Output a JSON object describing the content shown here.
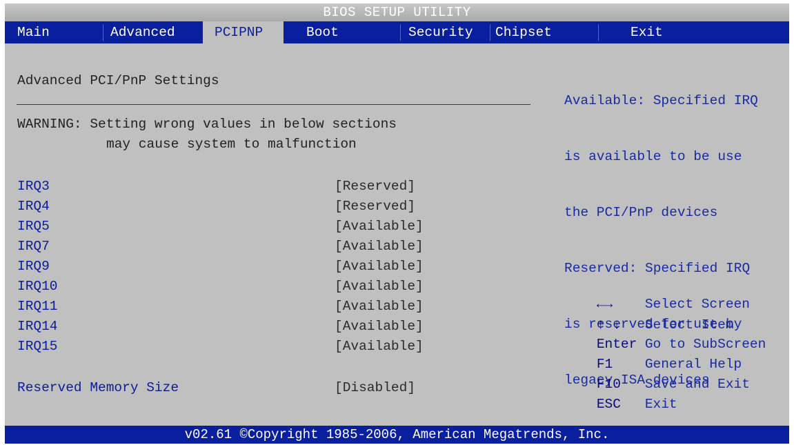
{
  "title": "BIOS SETUP UTILITY",
  "tabs": [
    {
      "label": "Main"
    },
    {
      "label": "Advanced"
    },
    {
      "label": "PCIPNP"
    },
    {
      "label": "Boot"
    },
    {
      "label": "Security"
    },
    {
      "label": "Chipset"
    },
    {
      "label": "Exit"
    }
  ],
  "active_tab": "PCIPNP",
  "section_title": "Advanced PCI/PnP Settings",
  "warning_line1": "WARNING: Setting wrong values in below sections",
  "warning_line2": "may cause system to malfunction",
  "settings": [
    {
      "label": "IRQ3",
      "value": "[Reserved]"
    },
    {
      "label": "IRQ4",
      "value": "[Reserved]"
    },
    {
      "label": "IRQ5",
      "value": "[Available]"
    },
    {
      "label": "IRQ7",
      "value": "[Available]"
    },
    {
      "label": "IRQ9",
      "value": "[Available]"
    },
    {
      "label": "IRQ10",
      "value": "[Available]"
    },
    {
      "label": "IRQ11",
      "value": "[Available]"
    },
    {
      "label": "IRQ14",
      "value": "[Available]"
    },
    {
      "label": "IRQ15",
      "value": "[Available]"
    },
    {
      "label": "Reserved Memory Size",
      "value": "[Disabled]"
    }
  ],
  "help": {
    "lines": [
      "Available: Specified IRQ",
      "is available to be use",
      "the PCI/PnP devices",
      "Reserved: Specified IRQ",
      "is reserved for use by",
      "legacy ISA devices"
    ]
  },
  "keys": [
    {
      "key": "←→",
      "action": "Select Screen",
      "icon": "left-right-arrows-icon"
    },
    {
      "key": "↑ ↓",
      "action": "Select Item",
      "icon": "up-down-arrows-icon"
    },
    {
      "key": "Enter",
      "action": "Go to SubScreen"
    },
    {
      "key": "F1",
      "action": "General Help"
    },
    {
      "key": "F10",
      "action": "Save and Exit"
    },
    {
      "key": "ESC",
      "action": "Exit"
    }
  ],
  "footer": "v02.61 ©Copyright 1985-2006, American Megatrends, Inc.",
  "colors": {
    "tab_bar": "#0a1f9e",
    "panel": "#c0c0c0",
    "label_blue": "#0c1b9a"
  }
}
